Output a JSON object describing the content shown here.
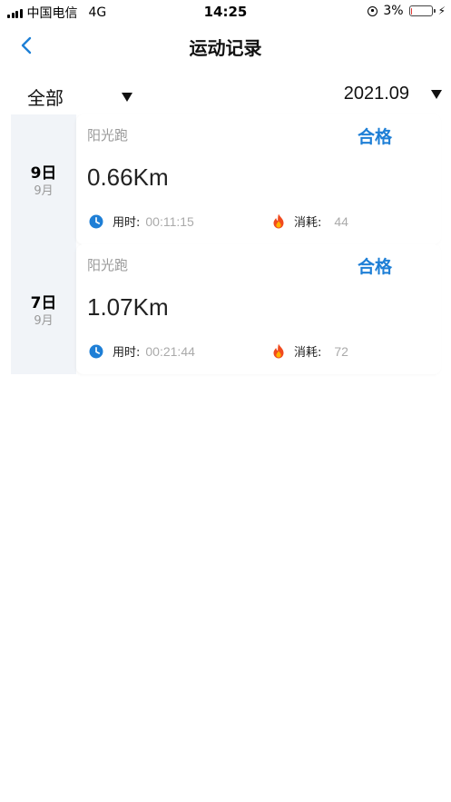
{
  "status_bar": {
    "carrier": "中国电信",
    "network": "4G",
    "time": "14:25",
    "battery_percent": "3%",
    "battery_level": 0.03,
    "battery_color": "#e53935"
  },
  "nav": {
    "back_icon": "chevron-left-icon",
    "title": "运动记录"
  },
  "filters": {
    "type_selected": "全部",
    "month_selected": "2021.09"
  },
  "records": [
    {
      "day": "9日",
      "month": "9月",
      "sport": "阳光跑",
      "status": "合格",
      "distance": "0.66Km",
      "time_label": "用时:",
      "time_value": "00:11:15",
      "cal_label": "消耗:",
      "cal_value": "44"
    },
    {
      "day": "7日",
      "month": "9月",
      "sport": "阳光跑",
      "status": "合格",
      "distance": "1.07Km",
      "time_label": "用时:",
      "time_value": "00:21:44",
      "cal_label": "消耗:",
      "cal_value": "72"
    }
  ],
  "colors": {
    "accent": "#1e7fd6",
    "muted": "#999999",
    "date_bg": "#f1f4f8"
  }
}
